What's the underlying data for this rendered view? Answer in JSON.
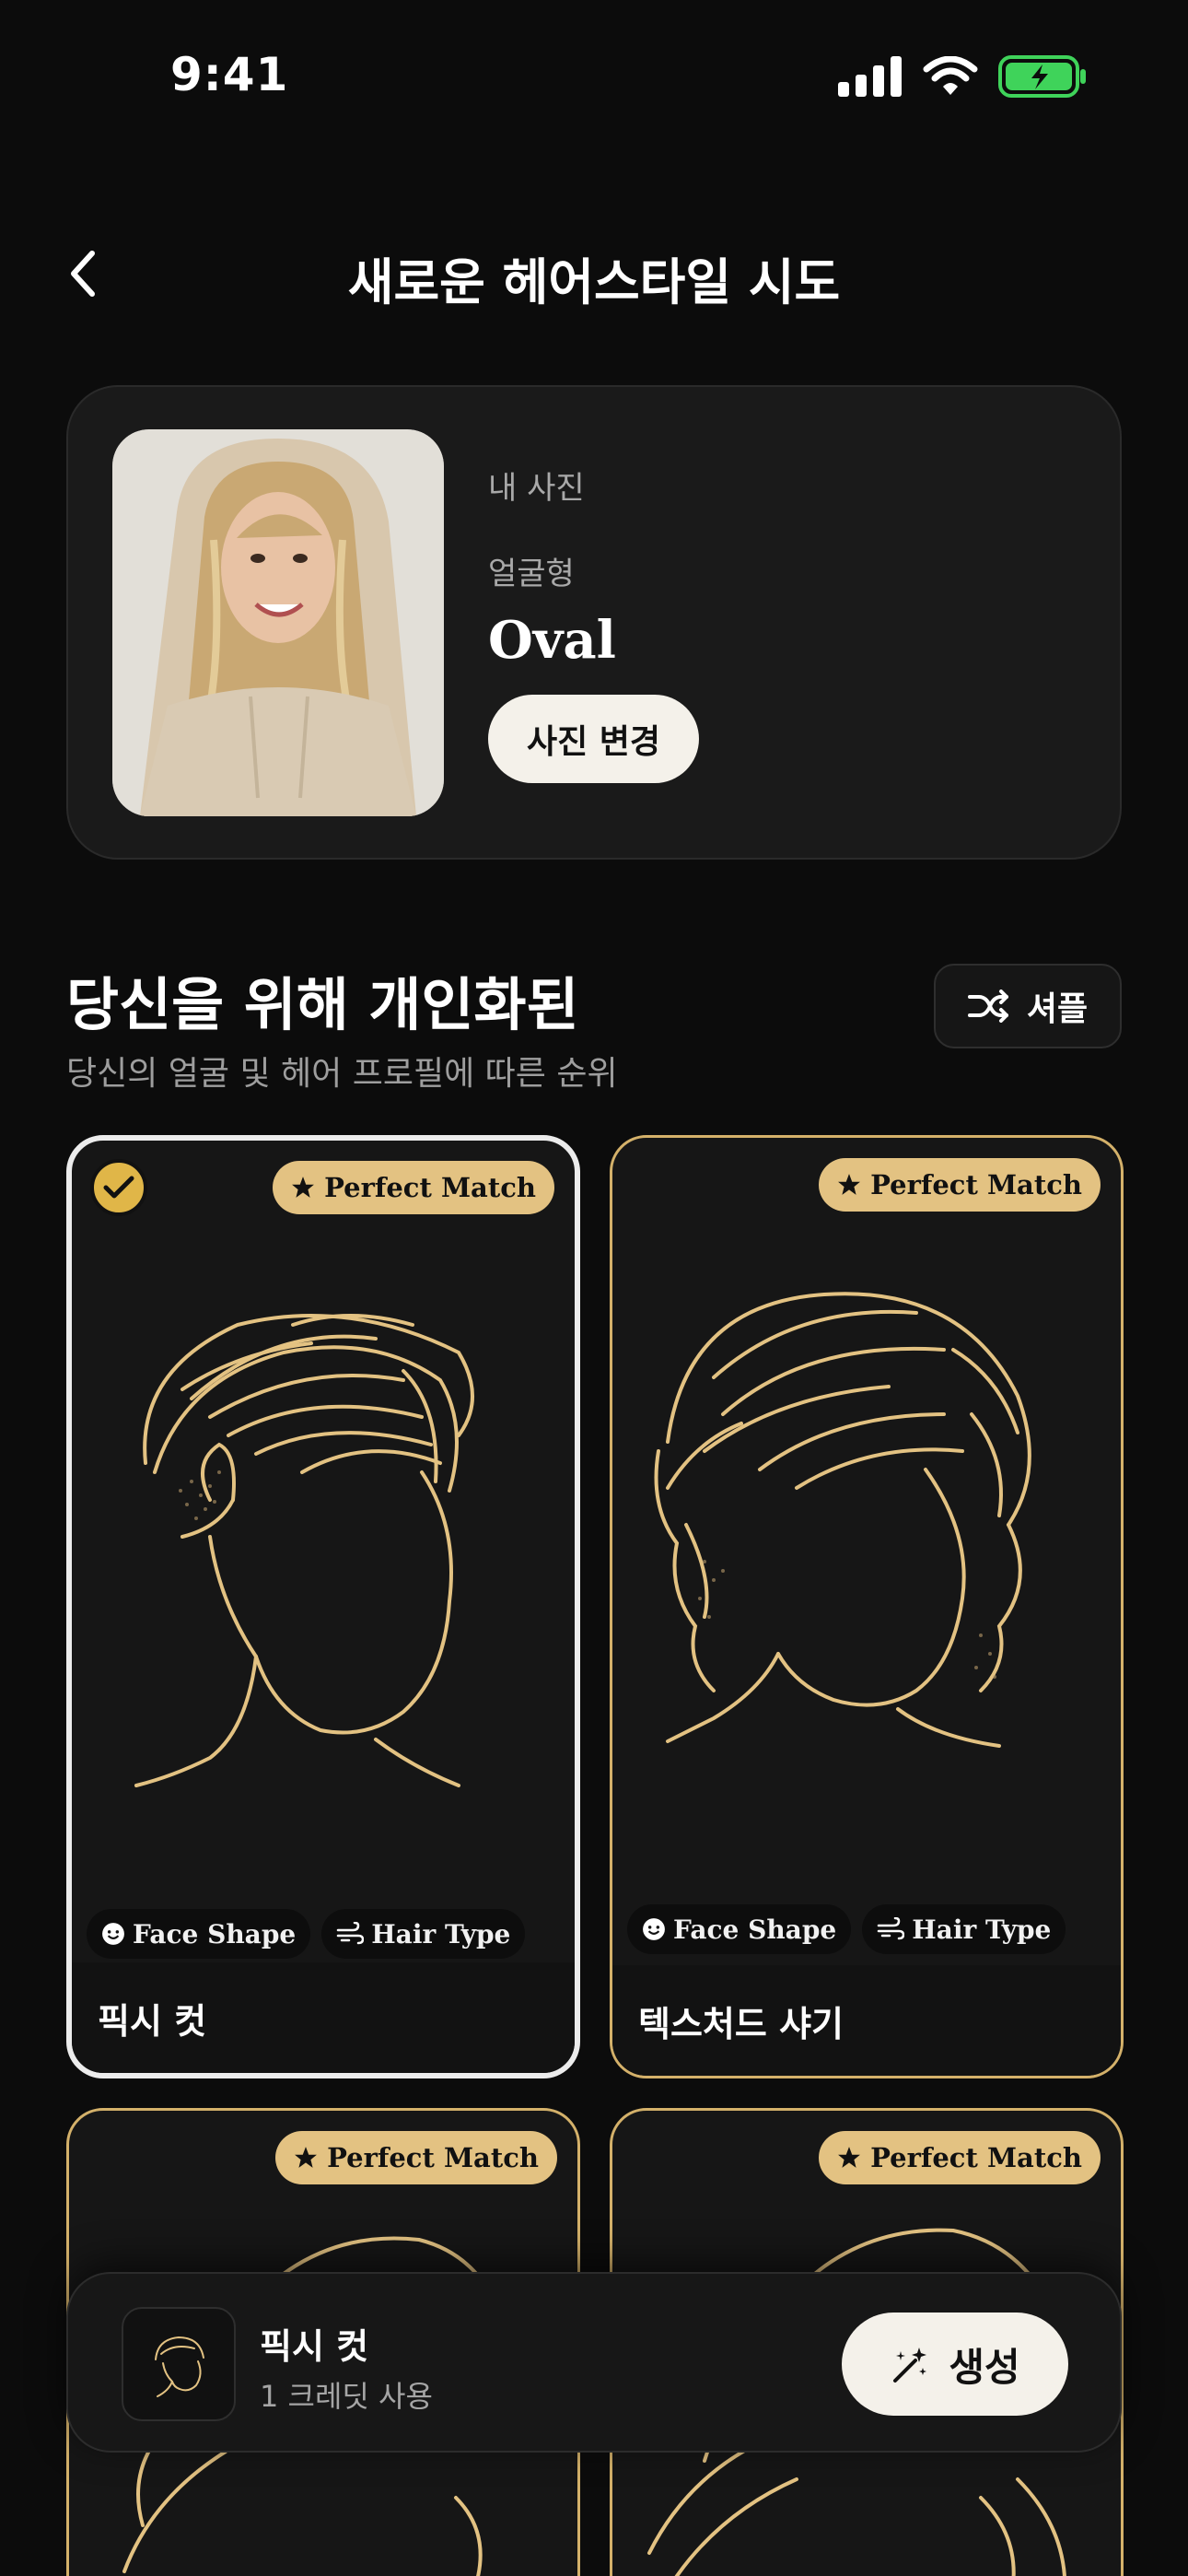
{
  "status_bar": {
    "time": "9:41"
  },
  "header": {
    "title": "새로운 헤어스타일 시도"
  },
  "profile": {
    "label": "내 사진",
    "face_shape_label": "얼굴형",
    "face_shape_value": "Oval",
    "change_button": "사진 변경"
  },
  "section": {
    "title": "당신을 위해 개인화된",
    "subtitle": "당신의 얼굴 및 헤어 프로필에 따른 순위",
    "shuffle_label": "셔플"
  },
  "cards": [
    {
      "name": "픽시 컷",
      "badge": "Perfect Match",
      "tag1": "Face Shape",
      "tag2": "Hair Type",
      "selected": true
    },
    {
      "name": "텍스처드 샤기",
      "badge": "Perfect Match",
      "tag1": "Face Shape",
      "tag2": "Hair Type",
      "selected": false
    },
    {
      "badge": "Perfect Match"
    },
    {
      "badge": "Perfect Match"
    }
  ],
  "bottom_bar": {
    "selected_name": "픽시 컷",
    "credit_text": "1 크레딧 사용",
    "generate_label": "생성"
  },
  "colors": {
    "accent_gold": "#e3c282",
    "line_gold": "#d4b16a",
    "background": "#0c0c0c",
    "battery_green": "#3fd35a"
  },
  "icons": [
    "back-chevron-icon",
    "shuffle-icon",
    "star-icon",
    "check-icon",
    "face-icon",
    "wind-icon",
    "magic-wand-icon",
    "signal-icon",
    "wifi-icon",
    "battery-icon"
  ]
}
